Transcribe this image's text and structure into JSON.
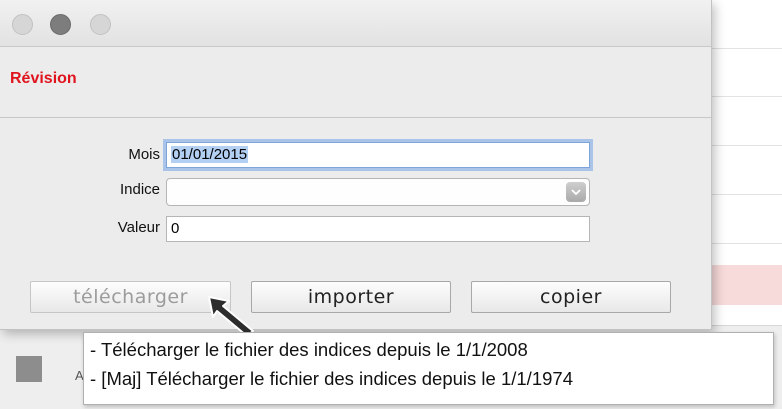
{
  "section": {
    "title": "Révision"
  },
  "form": {
    "mois": {
      "label": "Mois",
      "value": "01/01/2015"
    },
    "indice": {
      "label": "Indice",
      "value": ""
    },
    "valeur": {
      "label": "Valeur",
      "value": "0"
    }
  },
  "buttons": {
    "telecharger": "télécharger",
    "importer": "importer",
    "copier": "copier"
  },
  "tooltip": {
    "line1": "- Télécharger le fichier des indices depuis le 1/1/2008",
    "line2": "- [Maj] Télécharger le fichier des indices depuis le 1/1/1974"
  },
  "colors": {
    "section_title": "#e0141e",
    "selection": "#b3d0f3"
  },
  "icons": {
    "close": "close-icon",
    "minimize": "minimize-icon",
    "zoom": "zoom-icon",
    "select_arrow": "chevron-down-icon",
    "cursor": "arrow-cursor-icon"
  }
}
